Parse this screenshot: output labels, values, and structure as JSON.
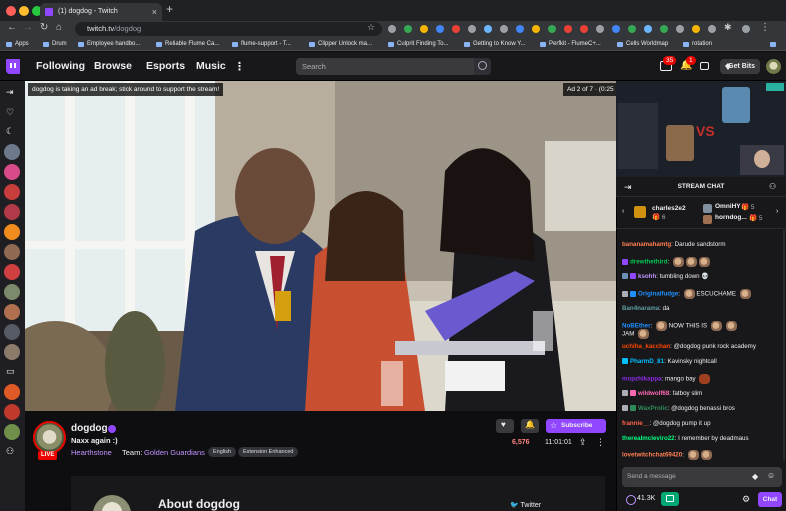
{
  "browser": {
    "tab_title": "(1) dogdog - Twitch",
    "url_host": "twitch.tv",
    "url_path": "/dogdog",
    "bookmarks": [
      "Apps",
      "Drum",
      "Employee handbo...",
      "Reliable Flume Ca...",
      "flume-support - T...",
      "Clipper Unlock ma...",
      "Culprit Finding To...",
      "Getting to Know Y...",
      "Perfkit - FlumeC+...",
      "Cells Worldmap",
      "rotation"
    ]
  },
  "nav": {
    "items": [
      "Following",
      "Browse",
      "Esports",
      "Music"
    ],
    "search_placeholder": "Search",
    "prime_badge": "35",
    "notif_badge": "1",
    "get_bits": "Get Bits"
  },
  "video": {
    "ad_note": "dogdog is taking an ad break; stick around to support the stream!",
    "ad_counter": "Ad 2 of 7 · (0:25"
  },
  "channel": {
    "name": "dogdog",
    "title": "Naxx again :)",
    "game": "Hearthstone",
    "team_label": "Team:",
    "team": "Golden Guardians",
    "tags": [
      "English",
      "Extension Enhanced"
    ],
    "live": "LIVE",
    "subscribe": "Subscribe",
    "viewers": "6,576",
    "uptime": "11:01:01",
    "about": "About dogdog",
    "twitter": "Twitter"
  },
  "chat": {
    "title": "STREAM CHAT",
    "gifters": [
      {
        "name": "charles2e2",
        "count": "6"
      },
      {
        "name": "OmniHY",
        "count": "5"
      },
      {
        "name": "horndog...",
        "count": "5"
      }
    ],
    "messages": [
      {
        "user": "bananamahamtg",
        "text": "Darude sandstorm",
        "color": "#ff7f50"
      },
      {
        "user": "drewthethird",
        "text": "",
        "color": "#00c853"
      },
      {
        "user": "ksohh",
        "text": "tumbling down",
        "color": "#bf94ff"
      },
      {
        "user": "Originalfudge",
        "text": "ESCUCHAME",
        "color": "#1e90ff"
      },
      {
        "user": "Ban4narama",
        "text": "da",
        "color": "#5f9ea0"
      },
      {
        "user": "NoBEther",
        "text": "NOW  THIS  IS",
        "color": "#1e90ff"
      },
      {
        "user": "",
        "text": "JAM",
        "color": "#efeff1"
      },
      {
        "user": "uchiha_kacchan",
        "text": "@dogdog punk rock academy",
        "color": "#ff4500"
      },
      {
        "user": "PharmD_81",
        "text": "Kavinsky nightcall",
        "color": "#00bfff"
      },
      {
        "user": "mopzhikappa",
        "text": "mango bay",
        "color": "#8a2be2"
      },
      {
        "user": "wildwolf68",
        "text": "fatboy slim",
        "color": "#ff69b4"
      },
      {
        "user": "WaxProlic",
        "text": "@dogdog benassi bros",
        "color": "#2e8b57"
      },
      {
        "user": "frannie__",
        "text": "@dogdog pump it up",
        "color": "#ff6347"
      },
      {
        "user": "therealmcleviro22",
        "text": "I remember by deadmaus",
        "color": "#00ff7f"
      },
      {
        "user": "lovetwitchchat69420",
        "text": "",
        "color": "#ff7f50"
      }
    ],
    "input_placeholder": "Send a message",
    "points": "41.3K",
    "chat_button": "Chat"
  }
}
